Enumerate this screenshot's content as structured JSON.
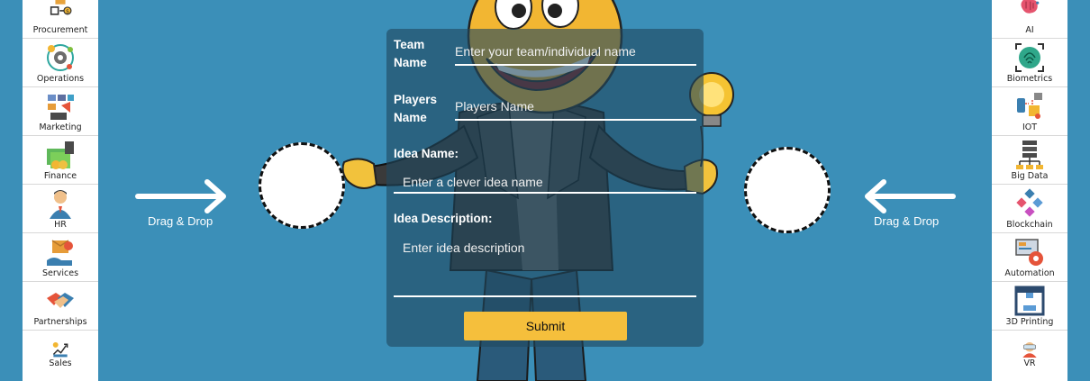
{
  "left_sidebar": {
    "items": [
      {
        "label": "Procurement",
        "icon": "procurement-icon"
      },
      {
        "label": "Operations",
        "icon": "operations-icon"
      },
      {
        "label": "Marketing",
        "icon": "marketing-icon"
      },
      {
        "label": "Finance",
        "icon": "finance-icon"
      },
      {
        "label": "HR",
        "icon": "hr-icon"
      },
      {
        "label": "Services",
        "icon": "services-icon"
      },
      {
        "label": "Partnerships",
        "icon": "partnerships-icon"
      },
      {
        "label": "Sales",
        "icon": "sales-icon"
      }
    ]
  },
  "right_sidebar": {
    "items": [
      {
        "label": "AI",
        "icon": "ai-brain-icon"
      },
      {
        "label": "Biometrics",
        "icon": "biometrics-icon"
      },
      {
        "label": "IOT",
        "icon": "iot-icon"
      },
      {
        "label": "Big Data",
        "icon": "big-data-icon"
      },
      {
        "label": "Blockchain",
        "icon": "blockchain-icon"
      },
      {
        "label": "Automation",
        "icon": "automation-icon"
      },
      {
        "label": "3D Printing",
        "icon": "3d-printing-icon"
      },
      {
        "label": "VR",
        "icon": "vr-icon"
      }
    ]
  },
  "drop_zones": {
    "left_label": "Drag & Drop",
    "right_label": "Drag & Drop"
  },
  "form": {
    "team_label": "Team Name",
    "team_placeholder": "Enter your team/individual name",
    "players_label": "Players Name",
    "players_placeholder": "Players Name",
    "idea_label": "Idea Name:",
    "idea_placeholder": "Enter a clever idea name",
    "description_label": "Idea Description:",
    "description_placeholder": "Enter idea description",
    "submit_label": "Submit"
  },
  "colors": {
    "background": "#3b8fb8",
    "submit_button": "#f5bf3c",
    "form_overlay": "rgba(32,72,96,0.62)"
  }
}
